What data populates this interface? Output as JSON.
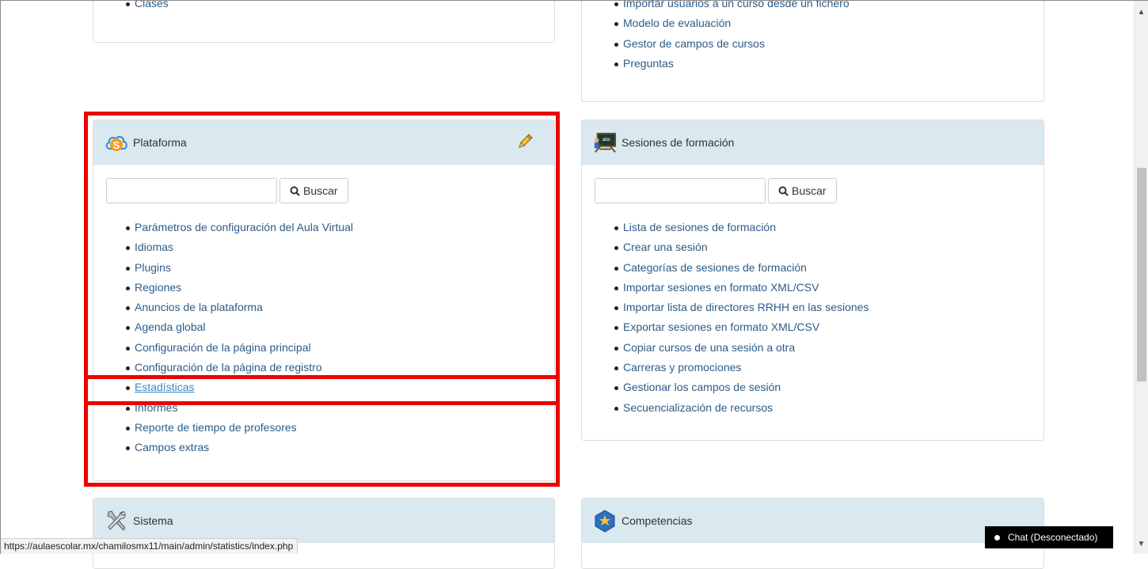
{
  "top_left_panel": {
    "items": [
      "Clases"
    ]
  },
  "top_right_panel": {
    "items": [
      "Importar usuarios a un curso desde un fichero",
      "Modelo de evaluación",
      "Gestor de campos de cursos",
      "Preguntas"
    ]
  },
  "plataforma": {
    "title": "Plataforma",
    "search_button": "Buscar",
    "search_value": "",
    "items": [
      "Parámetros de configuración del Aula Virtual",
      "Idiomas",
      "Plugins",
      "Regiones",
      "Anuncios de la plataforma",
      "Agenda global",
      "Configuración de la página principal",
      "Configuración de la página de registro",
      "Estadísticas",
      "Informes",
      "Reporte de tiempo de profesores",
      "Campos extras"
    ]
  },
  "sesiones": {
    "title": "Sesiones de formación",
    "search_button": "Buscar",
    "search_value": "",
    "items": [
      "Lista de sesiones de formación",
      "Crear una sesión",
      "Categorías de sesiones de formación",
      "Importar sesiones en formato XML/CSV",
      "Importar lista de directores RRHH en las sesiones",
      "Exportar sesiones en formato XML/CSV",
      "Copiar cursos de una sesión a otra",
      "Carreras y promociones",
      "Gestionar los campos de sesión",
      "Secuencialización de recursos"
    ]
  },
  "sistema": {
    "title": "Sistema"
  },
  "competencias": {
    "title": "Competencias"
  },
  "status_bar": {
    "url": "https://aulaescolar.mx/chamilosmx11/main/admin/statistics/index.php"
  },
  "chat": {
    "label": "Chat (Desconectado)"
  },
  "colors": {
    "link": "#2d5b87",
    "panel_header": "#dae9ef",
    "highlight": "#ee0000"
  }
}
